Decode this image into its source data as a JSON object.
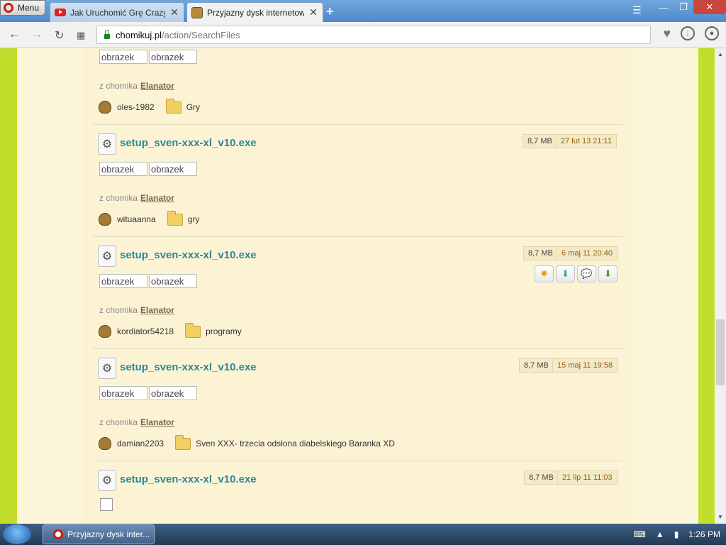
{
  "browser": {
    "menu_label": "Menu",
    "tabs": [
      {
        "title": "Jak Uruchomić Grę Crazy Dr",
        "active": false
      },
      {
        "title": "Przyjazny dysk internetowy",
        "active": true
      }
    ],
    "url_domain": "chomikuj.pl",
    "url_path": "/action/SearchFiles"
  },
  "first_item": {
    "thumb_labels": [
      "obrazek",
      "obrazek"
    ],
    "from_label": "z chomika",
    "from_user": "Elanator",
    "owner": "oles-1982",
    "folder": "Gry"
  },
  "files": [
    {
      "name": "setup_sven-xxx-xl_v10.exe",
      "size": "8,7 MB",
      "date": "27 lut 13 21:11",
      "thumb_labels": [
        "obrazek",
        "obrazek"
      ],
      "from_label": "z chomika",
      "from_user": "Elanator",
      "owner": "wituaanna",
      "folder": "gry"
    },
    {
      "name": "setup_sven-xxx-xl_v10.exe",
      "size": "8,7 MB",
      "date": "6 maj 11 20:40",
      "thumb_labels": [
        "obrazek",
        "obrazek"
      ],
      "from_label": "z chomika",
      "from_user": "Elanator",
      "owner": "kordiator54218",
      "folder": "programy"
    },
    {
      "name": "setup_sven-xxx-xl_v10.exe",
      "size": "8,7 MB",
      "date": "15 maj 11 19:58",
      "thumb_labels": [
        "obrazek",
        "obrazek"
      ],
      "from_label": "z chomika",
      "from_user": "Elanator",
      "owner": "damian2203",
      "folder": "Sven XXX- trzecia odsłona diabelskiego Baranka XD"
    },
    {
      "name": "setup_sven-xxx-xl_v10.exe",
      "size": "8,7 MB",
      "date": "21 lip 11 11:03"
    }
  ],
  "taskbar": {
    "task_label": "Przyjazny dysk inter...",
    "clock": "1:26 PM"
  },
  "colors": {
    "accent_link": "#2a8a9b",
    "side_green": "#c2dd2b",
    "page_bg": "#fbf3d4"
  }
}
